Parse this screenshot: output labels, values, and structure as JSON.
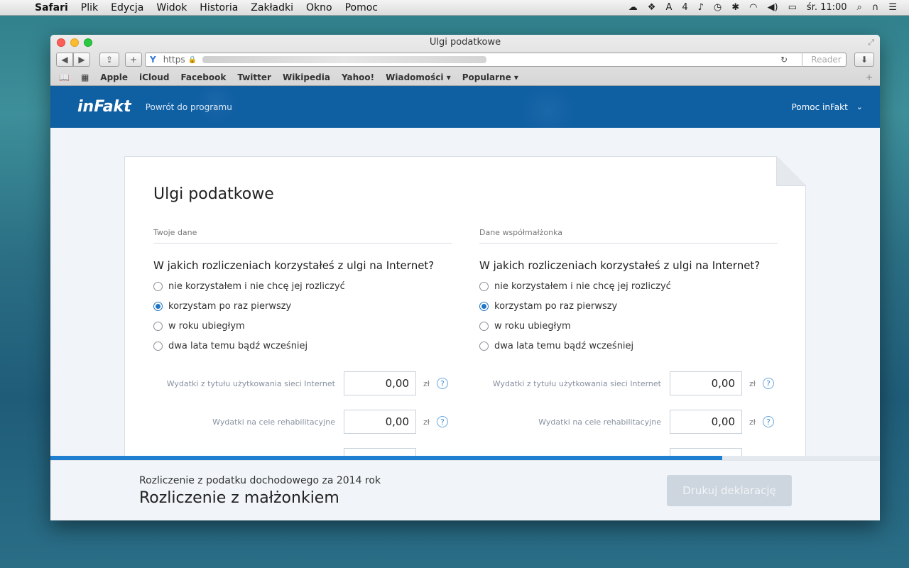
{
  "menubar": {
    "apple_icon": "apple-logo-icon",
    "items": [
      "Safari",
      "Plik",
      "Edycja",
      "Widok",
      "Historia",
      "Zakładki",
      "Okno",
      "Pomoc"
    ],
    "badge_count": "4",
    "clock": "śr. 11:00"
  },
  "browser": {
    "window_title": "Ulgi podatkowe",
    "address_protocol": "https",
    "reader_label": "Reader",
    "bookmarks": [
      "Apple",
      "iCloud",
      "Facebook",
      "Twitter",
      "Wikipedia",
      "Yahoo!",
      "Wiadomości ▾",
      "Popularne ▾"
    ]
  },
  "app": {
    "logo": "inFakt",
    "back_link": "Powrót do programu",
    "help_label": "Pomoc inFakt",
    "accent_color": "#0f5fa3"
  },
  "page": {
    "title": "Ulgi podatkowe",
    "left": {
      "section": "Twoje dane",
      "question": "W jakich rozliczeniach korzystałeś z ulgi na Internet?",
      "options": [
        "nie korzystałem i nie chcę jej rozliczyć",
        "korzystam po raz pierwszy",
        "w roku ubiegłym",
        "dwa lata temu bądź wcześniej"
      ],
      "selected_index": 1,
      "fields": [
        {
          "label": "Wydatki z tytułu użytkowania sieci Internet",
          "value": "0,00",
          "unit": "zł"
        },
        {
          "label": "Wydatki na cele rehabilitacyjne",
          "value": "0,00",
          "unit": "zł"
        }
      ]
    },
    "right": {
      "section": "Dane współmałżonka",
      "question": "W jakich rozliczeniach korzystałeś z ulgi na Internet?",
      "options": [
        "nie korzystałem i nie chcę jej rozliczyć",
        "korzystam po raz pierwszy",
        "w roku ubiegłym",
        "dwa lata temu bądź wcześniej"
      ],
      "selected_index": 1,
      "fields": [
        {
          "label": "Wydatki z tytułu użytkowania sieci Internet",
          "value": "0,00",
          "unit": "zł"
        },
        {
          "label": "Wydatki na cele rehabilitacyjne",
          "value": "0,00",
          "unit": "zł"
        }
      ]
    },
    "help_glyph": "?"
  },
  "footer": {
    "subtitle": "Rozliczenie z podatku dochodowego za 2014 rok",
    "title": "Rozliczenie z małżonkiem",
    "print_button": "Drukuj deklarację",
    "progress": 0.81
  }
}
